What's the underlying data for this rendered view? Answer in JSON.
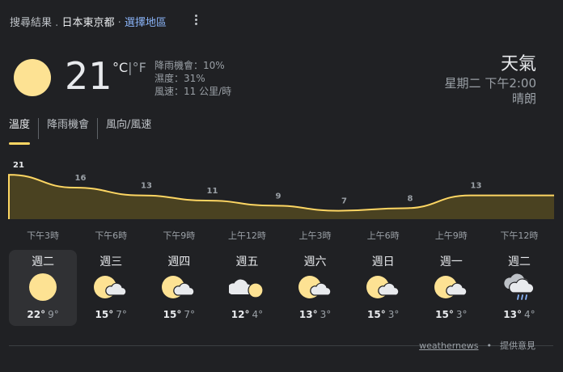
{
  "breadcrumb": {
    "prefix": "搜尋結果",
    "separator": ".",
    "location": "日本東京都",
    "separator2": "·",
    "link": "選擇地區"
  },
  "current": {
    "temperature": "21",
    "unit_c": "°C",
    "unit_sep": "|",
    "unit_f": "°F",
    "precipitation": "降雨機會：10%",
    "humidity": "濕度：31%",
    "wind": "風速：11 公里/時",
    "condition_icon": "sun-icon"
  },
  "header": {
    "title": "天氣",
    "datetime": "星期二 下午2:00",
    "condition": "晴朗"
  },
  "tabs": [
    {
      "label": "溫度",
      "active": true
    },
    {
      "label": "降雨機會",
      "active": false
    },
    {
      "label": "風向/風速",
      "active": false
    }
  ],
  "chart_data": {
    "type": "area",
    "title": "",
    "xlabel": "",
    "ylabel": "",
    "x": [
      "下午3時",
      "下午6時",
      "下午9時",
      "上午12時",
      "上午3時",
      "上午6時",
      "上午9時",
      "下午12時"
    ],
    "series": [
      {
        "name": "",
        "values": [
          21,
          16,
          13,
          11,
          9,
          7,
          8,
          13
        ]
      }
    ],
    "labels": [
      "21",
      "16",
      "13",
      "11",
      "9",
      "7",
      "8",
      "13"
    ],
    "fill_color": "#4a4221",
    "line_color": "#fdd663",
    "grid": false
  },
  "forecast": [
    {
      "day": "週二",
      "icon": "sun-icon",
      "high": "22°",
      "low": "9°",
      "selected": true
    },
    {
      "day": "週三",
      "icon": "partly-cloudy-icon",
      "high": "15°",
      "low": "7°",
      "selected": false
    },
    {
      "day": "週四",
      "icon": "partly-cloudy-icon",
      "high": "15°",
      "low": "7°",
      "selected": false
    },
    {
      "day": "週五",
      "icon": "mostly-cloudy-icon",
      "high": "12°",
      "low": "4°",
      "selected": false
    },
    {
      "day": "週六",
      "icon": "partly-cloudy-icon",
      "high": "13°",
      "low": "3°",
      "selected": false
    },
    {
      "day": "週日",
      "icon": "partly-cloudy-icon",
      "high": "15°",
      "low": "3°",
      "selected": false
    },
    {
      "day": "週一",
      "icon": "partly-cloudy-icon",
      "high": "15°",
      "low": "3°",
      "selected": false
    },
    {
      "day": "週二",
      "icon": "rain-icon",
      "high": "13°",
      "low": "4°",
      "selected": false
    }
  ],
  "footer": {
    "source": "weathernews",
    "bullet": "•",
    "feedback": "提供意見"
  },
  "colors": {
    "background": "#202124",
    "sun": "#fde293",
    "accent": "#fdd663",
    "link": "#8ab4f8"
  }
}
